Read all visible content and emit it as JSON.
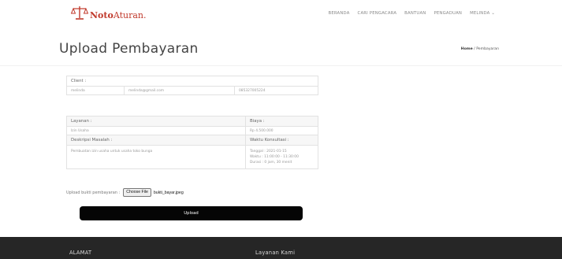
{
  "brand": {
    "part1": "Noto",
    "part2": "Aturan.",
    "color": "#c0392b"
  },
  "nav": [
    "BERANDA",
    "CARI PENGACARA",
    "BANTUAN",
    "PENGADUAN",
    "MELINDA ⌄"
  ],
  "page": {
    "title": "Upload Pembayaran"
  },
  "breadcrumb": {
    "home": "Home",
    "sep": "/",
    "current": "Pembayaran"
  },
  "client": {
    "header": "Client :",
    "name": "melinda",
    "email": "melinda@gmail.com",
    "phone": "085327005224"
  },
  "service": {
    "layanan_label": "Layanan :",
    "biaya_label": "Biaya :",
    "layanan_value": "Izin Usaha",
    "biaya_value": "Rp 4.500.000",
    "deskripsi_label": "Deskripsi Masalah :",
    "waktu_label": "Waktu Konsultasi :",
    "deskripsi_value": "Pembuatan izin usaha untuk usaha toko bunga",
    "tanggal": "Tanggal : 2021-01-15",
    "waktu": "Waktu : 11:00:00 - 11:30:00",
    "durasi": "Durasi : 0 jam, 30 menit"
  },
  "upload": {
    "label": "Upload bukti pembayaran :",
    "choose_label": "Choose File",
    "file_name": "bukti_bayar.jpeg",
    "button_label": "Upload"
  },
  "footer": {
    "alamat": "ALAMAT",
    "layanan": "Layanan Kami"
  }
}
